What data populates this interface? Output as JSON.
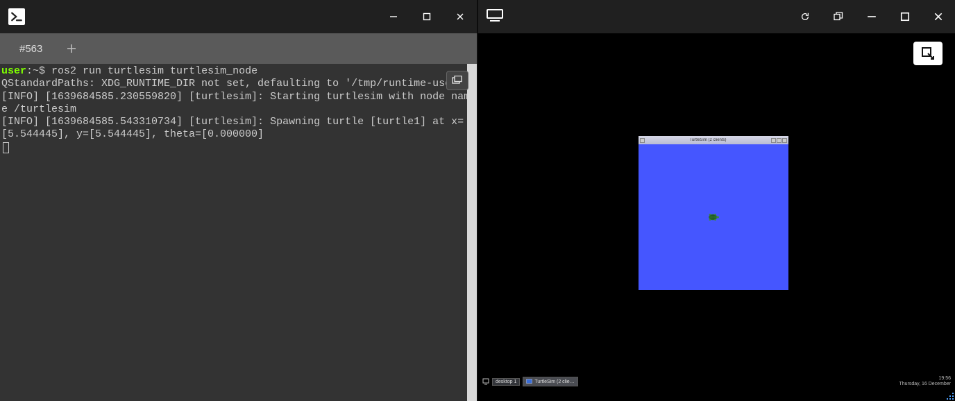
{
  "left": {
    "tab_label": "#563",
    "terminal": {
      "prompt_user": "user",
      "prompt_sep": ":~$ ",
      "command": "ros2 run turtlesim turtlesim_node",
      "lines": [
        "QStandardPaths: XDG_RUNTIME_DIR not set, defaulting to '/tmp/runtime-user'",
        "[INFO] [1639684585.230559820] [turtlesim]: Starting turtlesim with node name /turtlesim",
        "[INFO] [1639684585.543310734] [turtlesim]: Spawning turtle [turtle1] at x=[5.544445], y=[5.544445], theta=[0.000000]"
      ]
    }
  },
  "right": {
    "turtlesim": {
      "title": "TurtleSim (2 clients)",
      "canvas_color": "#4556ff"
    },
    "taskbar": {
      "desktop_label": "desktop 1",
      "task_label": "TurtleSim (2 clie…",
      "clock_time": "19:56",
      "clock_date": "Thursday, 16 December"
    }
  },
  "icons": {
    "minimize": "minimize-icon",
    "maximize": "maximize-icon",
    "close": "close-icon",
    "refresh": "refresh-icon",
    "restore": "restore-icon",
    "expand": "expand-icon",
    "add": "add-icon",
    "popup": "popup-icon"
  }
}
